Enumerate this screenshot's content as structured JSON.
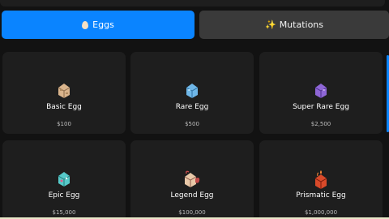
{
  "tabs": {
    "eggs": {
      "label": "Eggs",
      "icon": "egg-icon"
    },
    "mutations": {
      "label": "Mutations",
      "icon": "sparkles-icon",
      "glyph": "✨"
    }
  },
  "eggs": [
    {
      "name": "Basic Egg",
      "price": "$100",
      "icon": "basic-egg-icon",
      "color": "#d9b48c"
    },
    {
      "name": "Rare Egg",
      "price": "$500",
      "icon": "rare-egg-icon",
      "color": "#6fb7e8"
    },
    {
      "name": "Super Rare Egg",
      "price": "$2,500",
      "icon": "super-rare-egg-icon",
      "color": "#8e66d6"
    },
    {
      "name": "Epic Egg",
      "price": "$15,000",
      "icon": "epic-egg-icon",
      "color": "#56c9c9"
    },
    {
      "name": "Legend Egg",
      "price": "$100,000",
      "icon": "legend-egg-icon",
      "color": "#d98a7a"
    },
    {
      "name": "Prismatic Egg",
      "price": "$1,000,000",
      "icon": "prismatic-egg-icon",
      "color": "#d94a2a"
    }
  ]
}
